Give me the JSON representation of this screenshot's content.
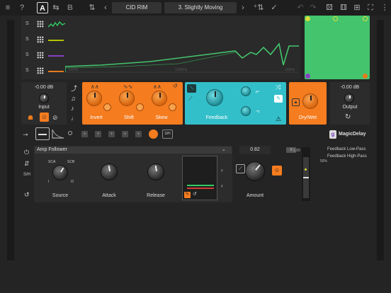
{
  "toolbar": {
    "menu_icon": "hamburger-icon",
    "help_label": "?",
    "ab_a": "A",
    "ab_b": "B",
    "preset_name": "CID RIM",
    "variant_name": "3. Slightly Moving",
    "prev_label": "‹",
    "next_label": "›"
  },
  "lanes": [
    {
      "label": "S",
      "color": "#33cc66"
    },
    {
      "label": "S",
      "color": "#b5c400"
    },
    {
      "label": "S",
      "color": "#8a3fc4"
    },
    {
      "label": "S",
      "color": "#e87a1c"
    }
  ],
  "env_axis": {
    "left": "100Hz",
    "mid": "1000Hz",
    "right": "10kHz"
  },
  "xy_pad": {
    "color": "#44c46c",
    "dot_colors": [
      "#d9df3a",
      "#7bd34a",
      "#33cc66",
      "#7b3fc4",
      "#e87a1c"
    ]
  },
  "input": {
    "value": "-0.00 dB",
    "label": "Input"
  },
  "output": {
    "value": "-0.00 dB",
    "label": "Output"
  },
  "orange_block": {
    "invert_label": "Invert",
    "shift_label": "Shift",
    "skew_label": "Skew"
  },
  "cyan_block": {
    "feedback_label": "Feedback"
  },
  "drywet": {
    "label": "Dry/Wet"
  },
  "brand": {
    "name": "MagicDelay"
  },
  "step_row": {
    "sh_label": "S/H"
  },
  "modulator": {
    "type": "Amp Follower",
    "source_label": "Source",
    "attack_label": "Attack",
    "release_label": "Release",
    "sca": "SCA",
    "scb": "SCB",
    "i_label": "I",
    "o_label": "O",
    "sh_label": "S/H"
  },
  "amount": {
    "value": "0.82",
    "label": "Amount"
  },
  "targets": {
    "slider_top": "1.00",
    "slider_mid": "50%",
    "items": [
      "Feedback Low-Pass",
      "Feedback High-Pass"
    ]
  }
}
